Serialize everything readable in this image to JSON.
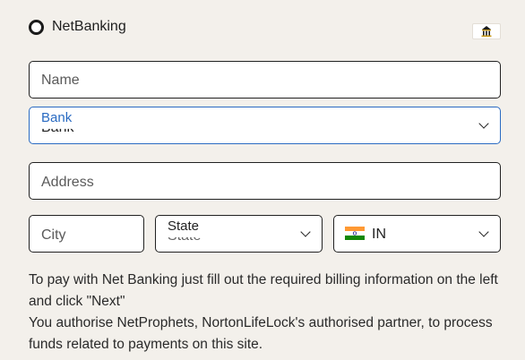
{
  "payment_method": {
    "label": "NetBanking",
    "selected": true,
    "logo_icon": "bank-building-icon"
  },
  "form": {
    "name": {
      "placeholder": "Name",
      "value": ""
    },
    "bank": {
      "label": "Bank",
      "selected_value": "Bank",
      "focused": true
    },
    "address": {
      "placeholder": "Address",
      "value": ""
    },
    "city": {
      "placeholder": "City",
      "value": ""
    },
    "state": {
      "label": "State",
      "selected_value": "State"
    },
    "country": {
      "code": "IN",
      "flag_icon": "india-flag-icon"
    }
  },
  "info": {
    "line1": "To pay with Net Banking just fill out the required billing information on the left and click \"Next\"",
    "line2": "You authorise NetProphets, NortonLifeLock's authorised partner, to process funds related to payments on this site."
  },
  "colors": {
    "background": "#f3f0eb",
    "focus_blue": "#2a6bc2",
    "border": "#222222"
  }
}
